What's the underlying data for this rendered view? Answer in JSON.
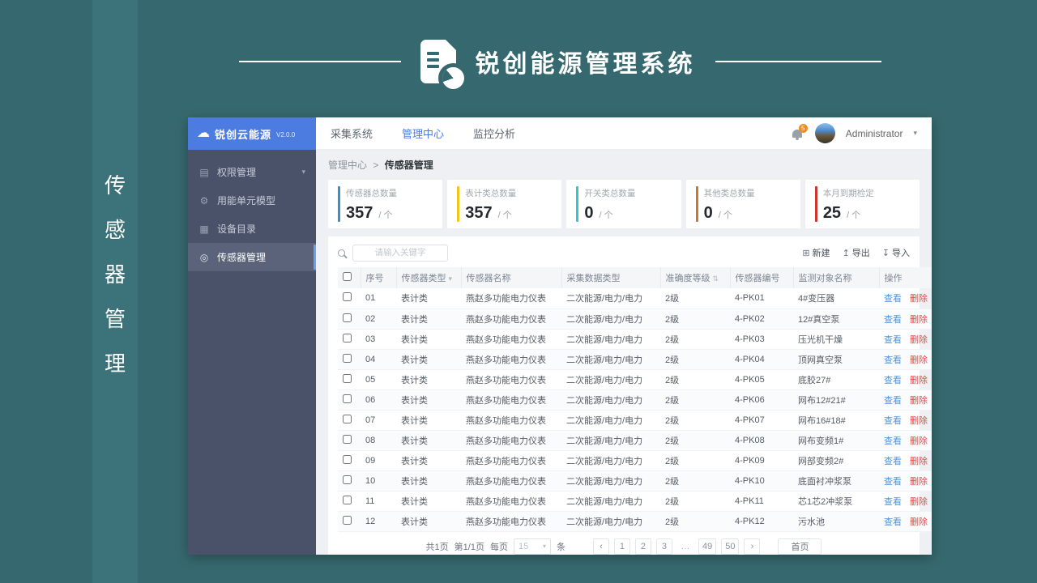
{
  "banner": {
    "title": "锐创能源管理系统"
  },
  "side_label": "传感器管理",
  "sidebar": {
    "logo": "锐创云能源",
    "version": "V2.0.0",
    "menu": [
      {
        "label": "权限管理",
        "icon": "permission-icon",
        "chevron": true,
        "active": false
      },
      {
        "label": "用能单元模型",
        "icon": "energy-unit-model-icon",
        "chevron": false,
        "active": false
      },
      {
        "label": "设备目录",
        "icon": "device-catalog-icon",
        "chevron": false,
        "active": false
      },
      {
        "label": "传感器管理",
        "icon": "sensor-icon",
        "chevron": false,
        "active": true
      }
    ]
  },
  "topbar": {
    "nav": [
      {
        "label": "采集系统",
        "active": false
      },
      {
        "label": "管理中心",
        "active": true
      },
      {
        "label": "监控分析",
        "active": false
      }
    ],
    "notification_count": "5",
    "user": "Administrator"
  },
  "breadcrumb": {
    "parent": "管理中心",
    "sep": ">",
    "current": "传感器管理"
  },
  "stats": [
    {
      "label": "传感器总数量",
      "value": "357",
      "unit": "/ 个",
      "color": "#3b8fc8"
    },
    {
      "label": "表计类总数量",
      "value": "357",
      "unit": "/ 个",
      "color": "#f2c51d"
    },
    {
      "label": "开关类总数量",
      "value": "0",
      "unit": "/ 个",
      "color": "#35c6ca"
    },
    {
      "label": "其他类总数量",
      "value": "0",
      "unit": "/ 个",
      "color": "#c8792f"
    },
    {
      "label": "本月到期检定",
      "value": "25",
      "unit": "/ 个",
      "color": "#cb372e"
    }
  ],
  "toolbar": {
    "search_placeholder": "请输入关键字",
    "new_label": "新建",
    "export_label": "导出",
    "import_label": "导入"
  },
  "table": {
    "columns": [
      "序号",
      "传感器类型",
      "传感器名称",
      "采集数据类型",
      "准确度等级",
      "传感器编号",
      "监测对象名称",
      "操作"
    ],
    "view_label": "查看",
    "delete_label": "删除",
    "rows": [
      {
        "no": "01",
        "type": "表计类",
        "name": "燕赵多功能电力仪表",
        "data_type": "二次能源/电力/电力",
        "level": "2级",
        "code": "4-PK01",
        "target": "4#变压器"
      },
      {
        "no": "02",
        "type": "表计类",
        "name": "燕赵多功能电力仪表",
        "data_type": "二次能源/电力/电力",
        "level": "2级",
        "code": "4-PK02",
        "target": "12#真空泵"
      },
      {
        "no": "03",
        "type": "表计类",
        "name": "燕赵多功能电力仪表",
        "data_type": "二次能源/电力/电力",
        "level": "2级",
        "code": "4-PK03",
        "target": "压光机干燥"
      },
      {
        "no": "04",
        "type": "表计类",
        "name": "燕赵多功能电力仪表",
        "data_type": "二次能源/电力/电力",
        "level": "2级",
        "code": "4-PK04",
        "target": "顶网真空泵"
      },
      {
        "no": "05",
        "type": "表计类",
        "name": "燕赵多功能电力仪表",
        "data_type": "二次能源/电力/电力",
        "level": "2级",
        "code": "4-PK05",
        "target": "底胶27#"
      },
      {
        "no": "06",
        "type": "表计类",
        "name": "燕赵多功能电力仪表",
        "data_type": "二次能源/电力/电力",
        "level": "2级",
        "code": "4-PK06",
        "target": "网布12#21#"
      },
      {
        "no": "07",
        "type": "表计类",
        "name": "燕赵多功能电力仪表",
        "data_type": "二次能源/电力/电力",
        "level": "2级",
        "code": "4-PK07",
        "target": "网布16#18#"
      },
      {
        "no": "08",
        "type": "表计类",
        "name": "燕赵多功能电力仪表",
        "data_type": "二次能源/电力/电力",
        "level": "2级",
        "code": "4-PK08",
        "target": "网布变频1#"
      },
      {
        "no": "09",
        "type": "表计类",
        "name": "燕赵多功能电力仪表",
        "data_type": "二次能源/电力/电力",
        "level": "2级",
        "code": "4-PK09",
        "target": "网部变频2#"
      },
      {
        "no": "10",
        "type": "表计类",
        "name": "燕赵多功能电力仪表",
        "data_type": "二次能源/电力/电力",
        "level": "2级",
        "code": "4-PK10",
        "target": "底面衬冲浆泵"
      },
      {
        "no": "11",
        "type": "表计类",
        "name": "燕赵多功能电力仪表",
        "data_type": "二次能源/电力/电力",
        "level": "2级",
        "code": "4-PK11",
        "target": "芯1芯2冲浆泵"
      },
      {
        "no": "12",
        "type": "表计类",
        "name": "燕赵多功能电力仪表",
        "data_type": "二次能源/电力/电力",
        "level": "2级",
        "code": "4-PK12",
        "target": "污水池"
      }
    ]
  },
  "pagination": {
    "total_pages": "共1页",
    "current": "第1/1页",
    "per_page_label": "每页",
    "per_page": "15",
    "unit_label": "条",
    "prev": "‹",
    "next": "›",
    "pages": [
      "1",
      "2",
      "3",
      "…",
      "49",
      "50"
    ],
    "home_label": "首页"
  }
}
